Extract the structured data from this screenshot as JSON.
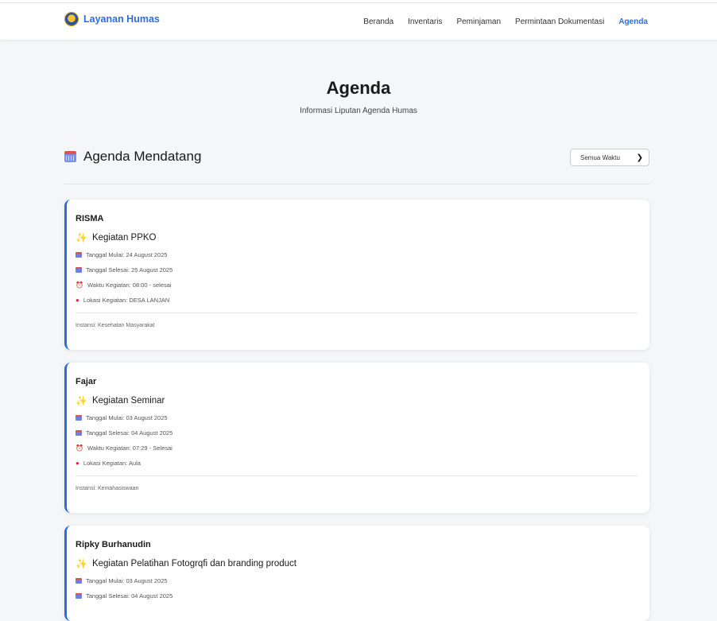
{
  "nav": {
    "brand": "Layanan Humas",
    "links": [
      "Beranda",
      "Inventaris",
      "Peminjaman",
      "Permintaan Dokumentasi",
      "Agenda"
    ],
    "active": "Agenda"
  },
  "hero": {
    "title": "Agenda",
    "subtitle": "Informasi Liputan Agenda Humas"
  },
  "section": {
    "title": "Agenda Mendatang",
    "filter_value": "Semua Waktu"
  },
  "agenda": [
    {
      "name": "RISMA",
      "event": "Kegiatan PPKO",
      "tanggal_mulai": "Tanggal Mulai: 24 August 2025",
      "tanggal_selesai": "Tanggal Selesai: 25 August 2025",
      "waktu": "Waktu Kegiatan: 08:00 - selesai",
      "lokasi": "Lokasi Kegiatan: DESA LANJAN",
      "instansi": "Instansi: Kesehatan Masyarakat"
    },
    {
      "name": "Fajar",
      "event": "Kegiatan Seminar",
      "tanggal_mulai": "Tanggal Mulai: 03 August 2025",
      "tanggal_selesai": "Tanggal Selesai: 04 August 2025",
      "waktu": "Waktu Kegiatan: 07:29 - Selesai",
      "lokasi": "Lokasi Kegiatan: Aula",
      "instansi": "Instansi: Kemahasiswaan"
    },
    {
      "name": "Ripky Burhanudin",
      "event": "Kegiatan Pelatihan Fotogrqfi dan branding product",
      "tanggal_mulai": "Tanggal Mulai: 03 August 2025",
      "tanggal_selesai": "Tanggal Selesai: 04 August 2025"
    }
  ],
  "colors": {
    "accent": "#2d6cdf",
    "background": "#f5f6f8",
    "card_border": "#2d6cdf"
  },
  "icons": {
    "calendar": "calendar-icon",
    "sparkle": "sparkle-icon",
    "clock": "alarm-clock-icon",
    "pin": "location-pin-icon"
  }
}
